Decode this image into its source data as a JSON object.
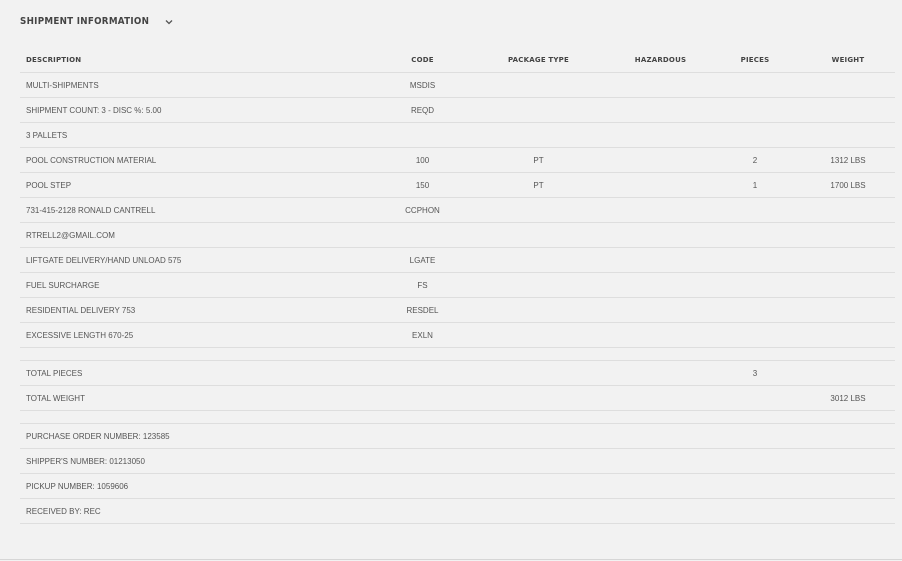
{
  "section": {
    "title": "SHIPMENT INFORMATION",
    "chevron_icon": "chevron-down-icon"
  },
  "table": {
    "headers": {
      "description": "DESCRIPTION",
      "code": "CODE",
      "package_type": "PACKAGE TYPE",
      "hazardous": "HAZARDOUS",
      "pieces": "PIECES",
      "weight": "WEIGHT"
    },
    "rows": [
      {
        "description": "MULTI-SHIPMENTS",
        "code": "MSDIS",
        "package_type": "",
        "hazardous": "",
        "pieces": "",
        "weight": ""
      },
      {
        "description": "SHIPMENT COUNT: 3 - DISC %: 5.00",
        "code": "REQD",
        "package_type": "",
        "hazardous": "",
        "pieces": "",
        "weight": ""
      },
      {
        "description": "3 PALLETS",
        "code": "",
        "package_type": "",
        "hazardous": "",
        "pieces": "",
        "weight": ""
      },
      {
        "description": "POOL CONSTRUCTION MATERIAL",
        "code": "100",
        "package_type": "PT",
        "hazardous": "",
        "pieces": "2",
        "weight": "1312 LBS"
      },
      {
        "description": "POOL STEP",
        "code": "150",
        "package_type": "PT",
        "hazardous": "",
        "pieces": "1",
        "weight": "1700 LBS"
      },
      {
        "description": "731-415-2128 RONALD CANTRELL",
        "code": "CCPHON",
        "package_type": "",
        "hazardous": "",
        "pieces": "",
        "weight": ""
      },
      {
        "description": "RTRELL2@GMAIL.COM",
        "code": "",
        "package_type": "",
        "hazardous": "",
        "pieces": "",
        "weight": ""
      },
      {
        "description": "LIFTGATE DELIVERY/HAND UNLOAD 575",
        "code": "LGATE",
        "package_type": "",
        "hazardous": "",
        "pieces": "",
        "weight": ""
      },
      {
        "description": "FUEL SURCHARGE",
        "code": "FS",
        "package_type": "",
        "hazardous": "",
        "pieces": "",
        "weight": ""
      },
      {
        "description": "RESIDENTIAL DELIVERY 753",
        "code": "RESDEL",
        "package_type": "",
        "hazardous": "",
        "pieces": "",
        "weight": ""
      },
      {
        "description": "EXCESSIVE LENGTH 670-25",
        "code": "EXLN",
        "package_type": "",
        "hazardous": "",
        "pieces": "",
        "weight": ""
      }
    ],
    "totals": [
      {
        "description": "TOTAL PIECES",
        "code": "",
        "package_type": "",
        "hazardous": "",
        "pieces": "3",
        "weight": ""
      },
      {
        "description": "TOTAL WEIGHT",
        "code": "",
        "package_type": "",
        "hazardous": "",
        "pieces": "",
        "weight": "3012 LBS"
      }
    ],
    "references": [
      {
        "description": "PURCHASE ORDER NUMBER: 123585"
      },
      {
        "description": "SHIPPER'S NUMBER: 01213050"
      },
      {
        "description": "PICKUP NUMBER: 1059606"
      },
      {
        "description": "RECEIVED BY: REC"
      }
    ]
  }
}
